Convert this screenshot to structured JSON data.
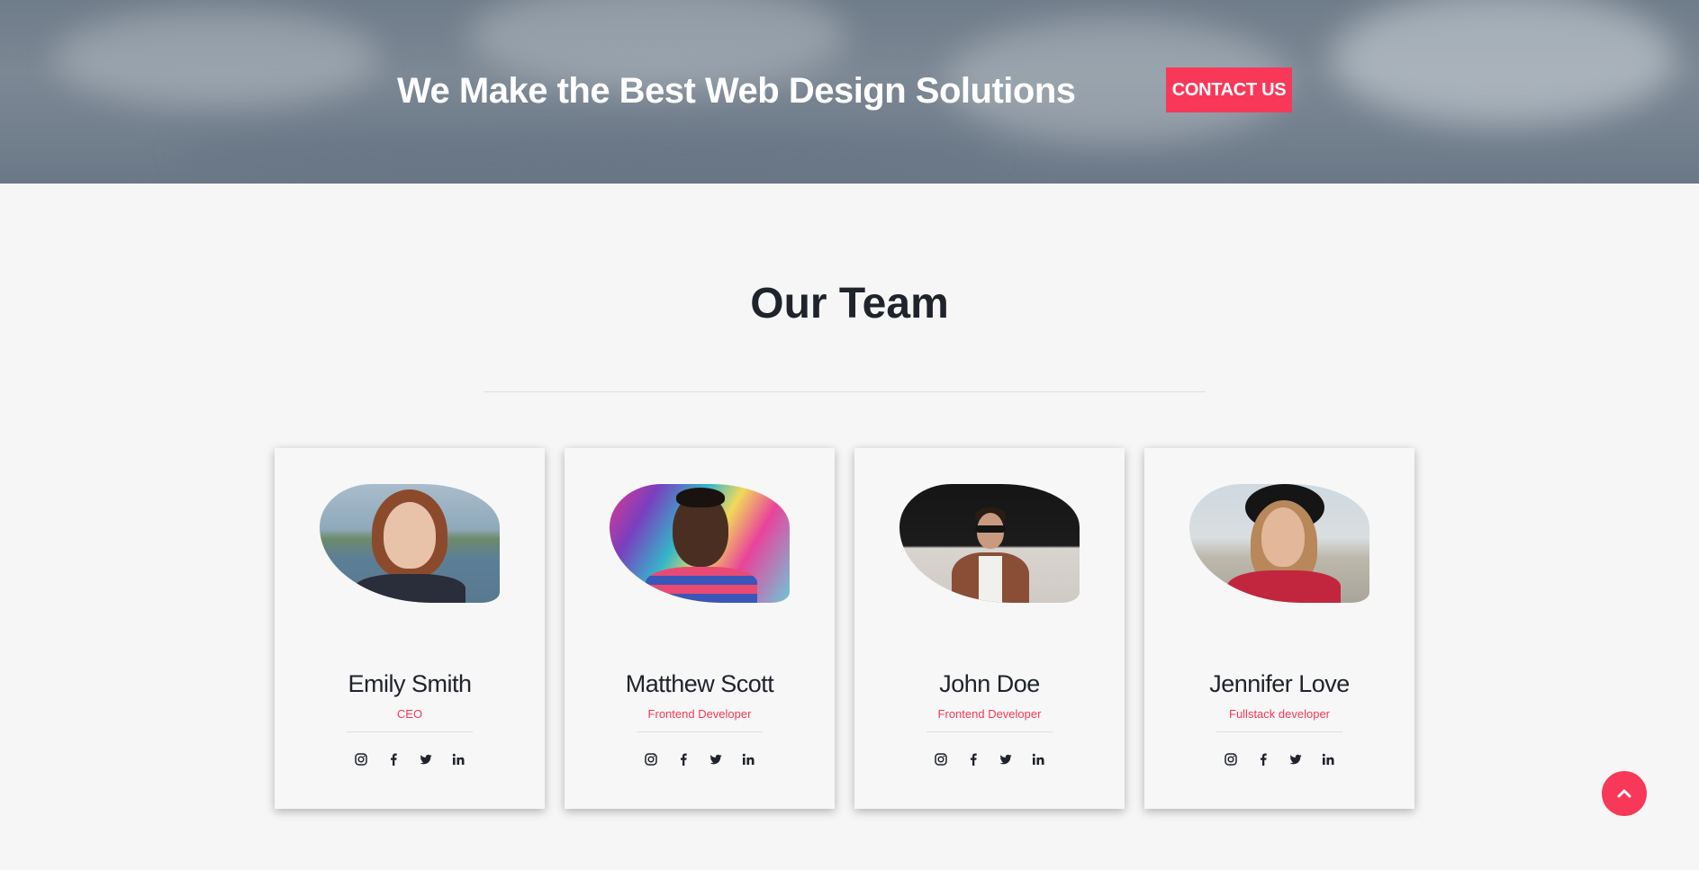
{
  "hero": {
    "title": "We Make the Best Web Design Solutions",
    "button_label": "CONTACT US"
  },
  "team": {
    "title": "Our Team",
    "members": [
      {
        "name": "Emily Smith",
        "role": "CEO",
        "socials": [
          "instagram-icon",
          "facebook-icon",
          "twitter-icon",
          "linkedin-icon"
        ]
      },
      {
        "name": "Matthew Scott",
        "role": "Frontend Developer",
        "socials": [
          "instagram-icon",
          "facebook-icon",
          "twitter-icon",
          "linkedin-icon"
        ]
      },
      {
        "name": "John Doe",
        "role": "Frontend Developer",
        "socials": [
          "instagram-icon",
          "facebook-icon",
          "twitter-icon",
          "linkedin-icon"
        ]
      },
      {
        "name": "Jennifer Love",
        "role": "Fullstack developer",
        "socials": [
          "instagram-icon",
          "facebook-icon",
          "twitter-icon",
          "linkedin-icon"
        ]
      }
    ]
  },
  "colors": {
    "accent": "#f73859",
    "text_dark": "#1f232b",
    "page_bg": "#f6f6f6"
  },
  "scroll_top_icon": "chevron-up-icon"
}
